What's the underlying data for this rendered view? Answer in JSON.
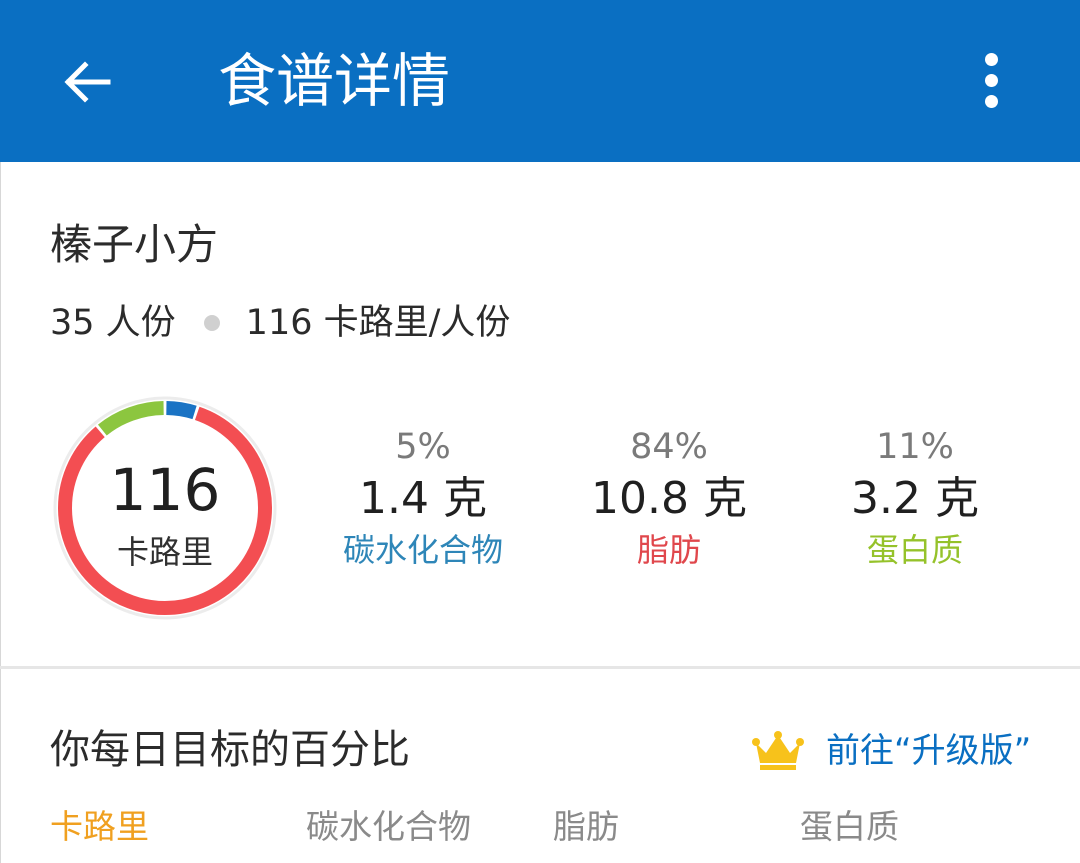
{
  "appbar": {
    "title": "食谱详情",
    "back_icon": "arrow-left-icon",
    "more_icon": "more-vert-icon",
    "background": "#0a6fc2"
  },
  "recipe": {
    "name": "榛子小方",
    "servings": "35 人份",
    "calories_per_serving": "116 卡路里/人份"
  },
  "calorie_ring": {
    "value": "116",
    "unit": "卡路里"
  },
  "macros": [
    {
      "percent": "5%",
      "amount": "1.4 克",
      "label": "碳水化合物",
      "color": "#2e86b8"
    },
    {
      "percent": "84%",
      "amount": "10.8 克",
      "label": "脂肪",
      "color": "#e0474c"
    },
    {
      "percent": "11%",
      "amount": "3.2 克",
      "label": "蛋白质",
      "color": "#95c22a"
    }
  ],
  "chart_data": {
    "type": "pie",
    "style": "donut",
    "center_value": "116",
    "center_label": "卡路里",
    "slices": [
      {
        "name": "碳水化合物",
        "value": 5,
        "color": "#1a73c4"
      },
      {
        "name": "脂肪",
        "value": 84,
        "color": "#f34e52"
      },
      {
        "name": "蛋白质",
        "value": 11,
        "color": "#8cc63f"
      }
    ]
  },
  "daily_goal": {
    "title": "你每日目标的百分比",
    "upgrade_icon": "crown-icon",
    "upgrade_label": "前往“升级版”",
    "crown_color": "#f7c21b",
    "tabs": [
      {
        "label": "卡路里",
        "active": true,
        "color": "#f0a020"
      },
      {
        "label": "碳水化合物",
        "active": false
      },
      {
        "label": "脂肪",
        "active": false
      },
      {
        "label": "蛋白质",
        "active": false
      }
    ]
  }
}
